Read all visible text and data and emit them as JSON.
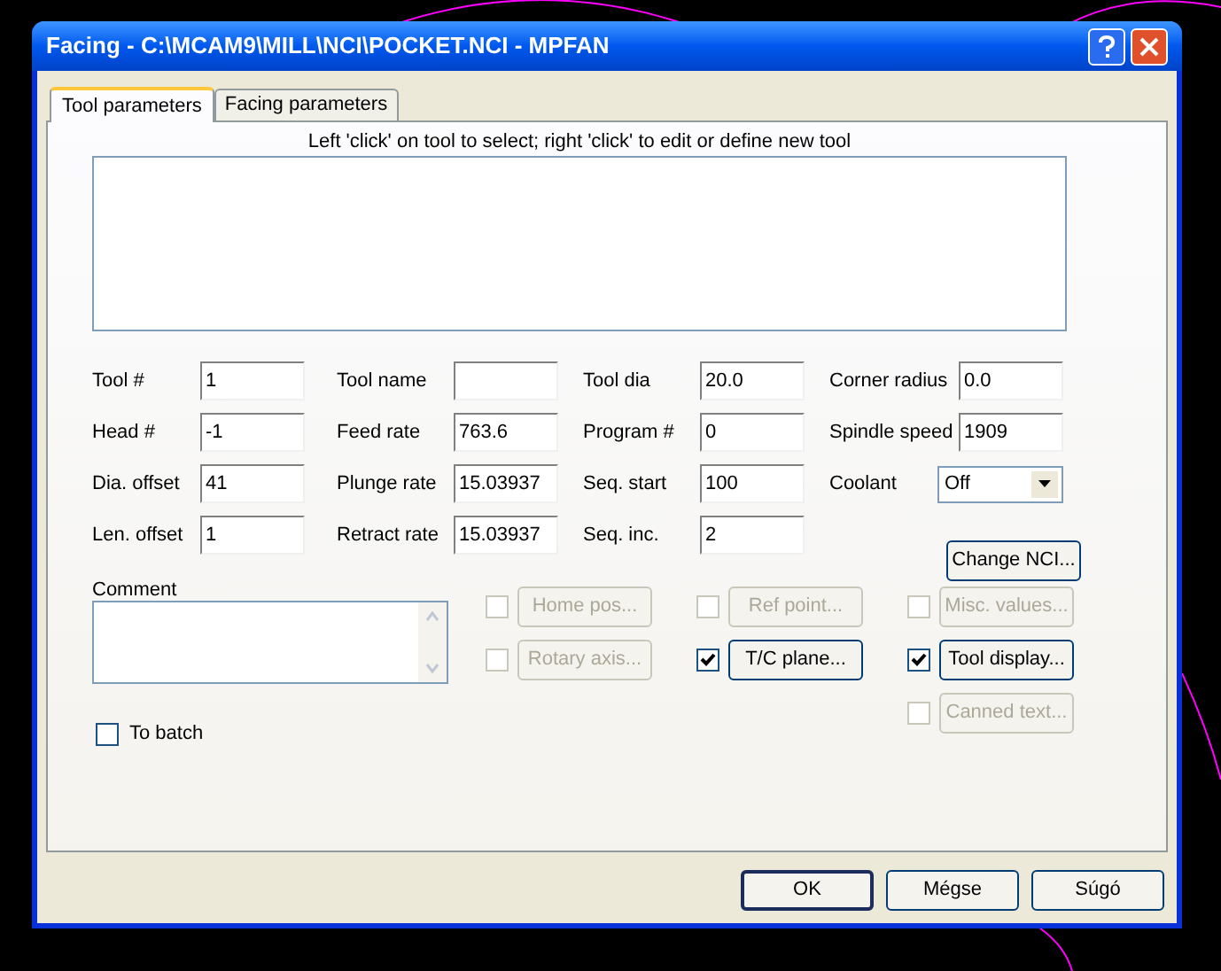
{
  "window": {
    "title": "Facing - C:\\MCAM9\\MILL\\NCI\\POCKET.NCI - MPFAN"
  },
  "tabs": [
    {
      "label": "Tool parameters",
      "selected": true
    },
    {
      "label": "Facing parameters",
      "selected": false
    }
  ],
  "hint": "Left 'click' on tool to select; right 'click' to edit or define new tool",
  "field_rows": [
    [
      {
        "kind": "text",
        "label": "Tool #",
        "value": "1"
      },
      {
        "kind": "text",
        "label": "Tool name"
      },
      {
        "kind": "text",
        "label": "Tool dia",
        "value": "20.0"
      },
      {
        "kind": "text",
        "label": "Corner radius",
        "value": "0.0"
      }
    ],
    [
      {
        "kind": "text",
        "label": "Head #",
        "value": "-1"
      },
      {
        "kind": "text",
        "label": "Feed rate",
        "value": "763.6"
      },
      {
        "kind": "text",
        "label": "Program #",
        "value": "0"
      },
      {
        "kind": "text",
        "label": "Spindle speed",
        "value": "1909"
      }
    ],
    [
      {
        "kind": "text",
        "label": "Dia. offset",
        "value": "41"
      },
      {
        "kind": "text",
        "label": "Plunge rate",
        "value": "15.03937"
      },
      {
        "kind": "text",
        "label": "Seq. start",
        "value": "100"
      },
      {
        "kind": "dropdown",
        "label": "Coolant",
        "value": "Off"
      }
    ],
    [
      {
        "kind": "text",
        "label": "Len. offset",
        "value": "1"
      },
      {
        "kind": "text",
        "label": "Retract rate",
        "value": "15.03937"
      },
      {
        "kind": "text",
        "label": "Seq. inc.",
        "value": "2"
      }
    ]
  ],
  "change_nci_button": "Change NCI...",
  "comment": {
    "label": "Comment"
  },
  "to_batch": {
    "label": "To batch",
    "checked": false
  },
  "option_columns": [
    [
      {
        "label": "Home pos...",
        "checked": false,
        "disabled": true
      },
      {
        "label": "Rotary axis...",
        "checked": false,
        "disabled": true
      }
    ],
    [
      {
        "label": "Ref point...",
        "checked": false,
        "disabled": true
      },
      {
        "label": "T/C plane...",
        "checked": true,
        "disabled": false
      }
    ],
    [
      {
        "label": "Misc. values...",
        "checked": false,
        "disabled": true
      },
      {
        "label": "Tool display...",
        "checked": true,
        "disabled": false
      },
      {
        "label": "Canned text...",
        "checked": false,
        "disabled": true
      }
    ]
  ],
  "buttons": [
    {
      "label": "OK",
      "default": true
    },
    {
      "label": "Mégse",
      "default": false
    },
    {
      "label": "Súgó",
      "default": false
    }
  ]
}
